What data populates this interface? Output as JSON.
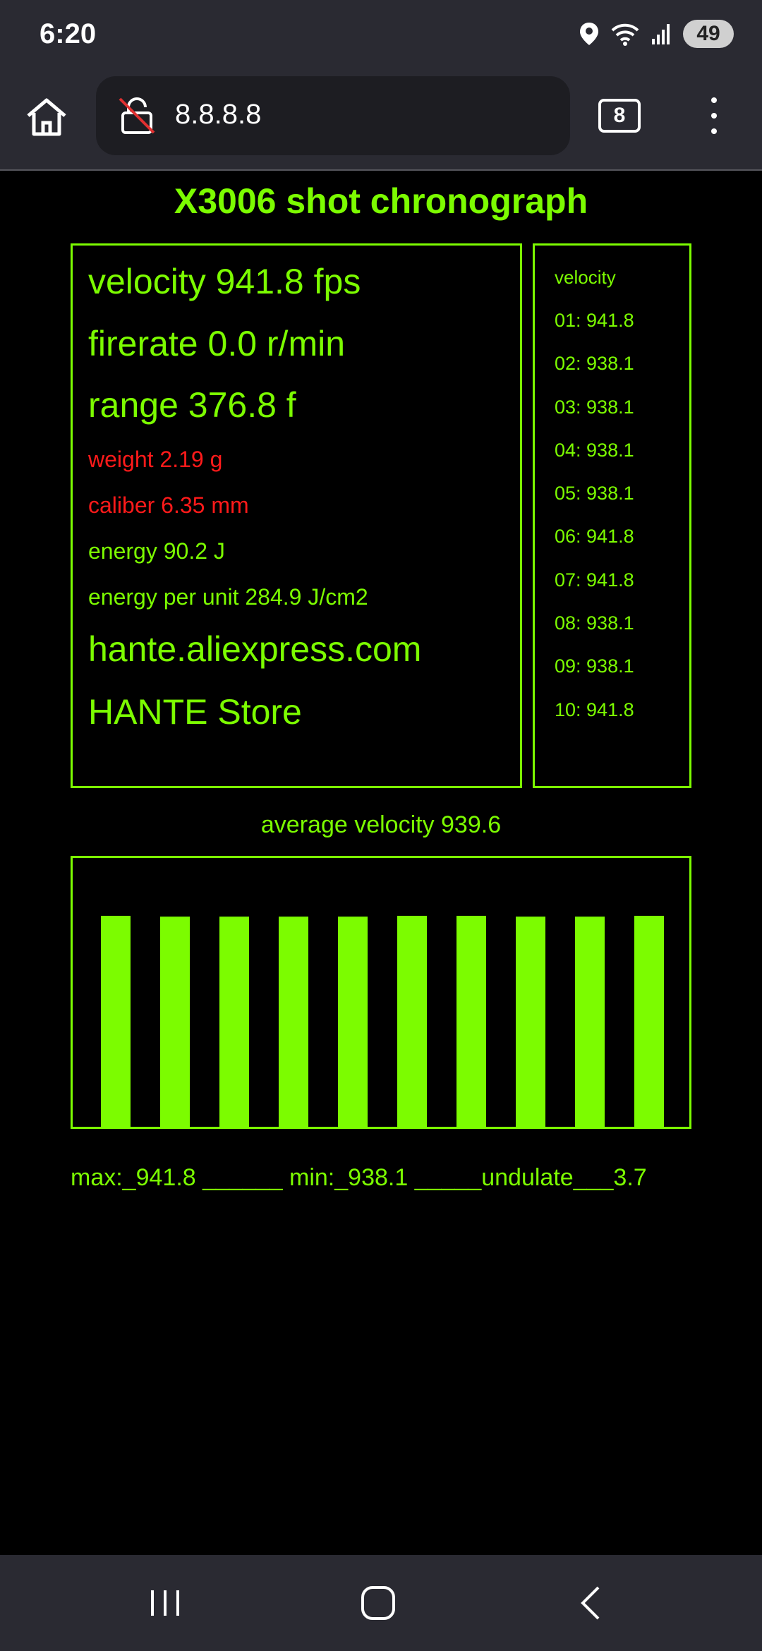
{
  "status": {
    "time": "6:20",
    "battery": "49"
  },
  "browser": {
    "url": "8.8.8.8",
    "tab_count": "8"
  },
  "page": {
    "title": "X3006 shot chronograph",
    "velocity": "velocity 941.8 fps",
    "firerate": "firerate 0.0 r/min",
    "range": "range 376.8 f",
    "weight": "weight 2.19 g",
    "caliber": "caliber 6.35 mm",
    "energy": "energy 90.2 J",
    "energy_per_unit": "energy per unit 284.9 J/cm2",
    "site": "hante.aliexpress.com",
    "store": "HANTE Store",
    "list_header": "velocity",
    "list": [
      "01: 941.8",
      "02: 938.1",
      "03: 938.1",
      "04: 938.1",
      "05: 938.1",
      "06: 941.8",
      "07: 941.8",
      "08: 938.1",
      "09: 938.1",
      "10: 941.8"
    ],
    "average": "average velocity 939.6",
    "stats": "max:_941.8 ______ min:_938.1 _____undulate___3.7"
  },
  "colors": {
    "accent": "#7CFC00",
    "warning": "#FF1A1A",
    "background": "#000000"
  },
  "chart_data": {
    "type": "bar",
    "categories": [
      "01",
      "02",
      "03",
      "04",
      "05",
      "06",
      "07",
      "08",
      "09",
      "10"
    ],
    "values": [
      941.8,
      938.1,
      938.1,
      938.1,
      938.1,
      941.8,
      941.8,
      938.1,
      938.1,
      941.8
    ],
    "ylim": [
      0,
      1200
    ],
    "grid": false,
    "color": "#7CFC00"
  }
}
